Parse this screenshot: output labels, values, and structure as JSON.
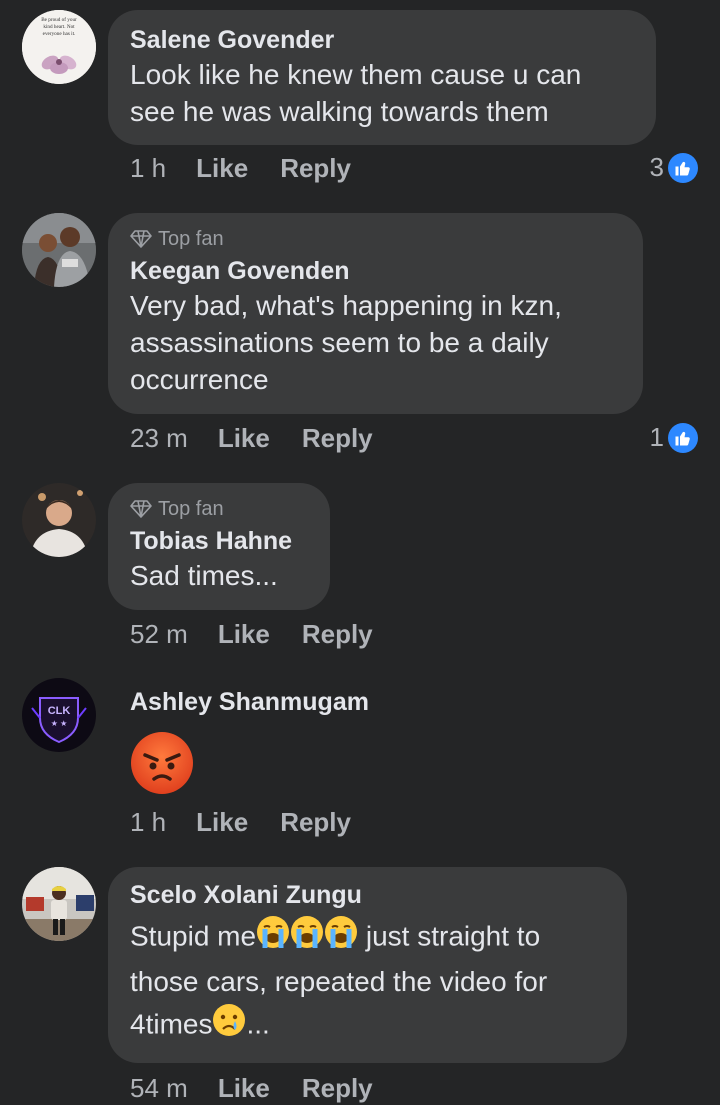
{
  "comments": [
    {
      "name": "Salene Govender",
      "top_fan": "",
      "text": "Look like he knew them cause u can see he was walking towards them",
      "time": "1 h",
      "like": "Like",
      "reply": "Reply",
      "reactions": "3",
      "avatar_quote": "Be proud of your kind heart. Not everyone has it."
    },
    {
      "name": "Keegan Govenden",
      "top_fan": "Top fan",
      "text": "Very bad, what's happening in kzn, assassinations seem to be a daily occurrence",
      "time": "23 m",
      "like": "Like",
      "reply": "Reply",
      "reactions": "1"
    },
    {
      "name": "Tobias Hahne",
      "top_fan": "Top fan",
      "text": "Sad times...",
      "time": "52 m",
      "like": "Like",
      "reply": "Reply"
    },
    {
      "name": "Ashley Shanmugam",
      "text": "",
      "time": "1 h",
      "like": "Like",
      "reply": "Reply",
      "avatar_text": "CLK"
    },
    {
      "name": "Scelo Xolani Zungu",
      "text_part1": "Stupid me",
      "text_part2": " just straight to those cars, repeated the video for 4times",
      "text_part3": "...",
      "time": "54 m",
      "like": "Like",
      "reply": "Reply"
    }
  ],
  "colors": {
    "background": "#242526",
    "bubble": "#3a3b3c",
    "like_badge": "#2d88ff"
  }
}
